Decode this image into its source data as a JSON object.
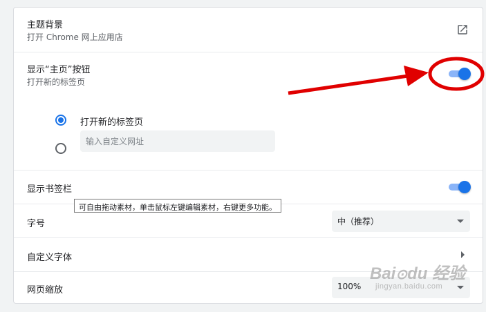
{
  "theme": {
    "title": "主题背景",
    "subtitle": "打开 Chrome 网上应用店",
    "icon": "open-in-new-icon"
  },
  "home_button": {
    "title": "显示“主页”按钮",
    "subtitle": "打开新的标签页",
    "enabled": true,
    "options": [
      {
        "label": "打开新的标签页",
        "selected": true
      },
      {
        "label": "",
        "selected": false,
        "placeholder": "输入自定义网址"
      }
    ]
  },
  "bookmarks_bar": {
    "title": "显示书签栏",
    "enabled": true
  },
  "tooltip": {
    "text": "可自由拖动素材，单击鼠标左键编辑素材，右键更多功能。"
  },
  "font_size": {
    "title": "字号",
    "value": "中（推荐）"
  },
  "custom_fonts": {
    "title": "自定义字体"
  },
  "page_zoom": {
    "title": "网页缩放",
    "value": "100%"
  },
  "colors": {
    "accent": "#1a73e8",
    "annotation": "#e00000"
  },
  "watermark": {
    "brand": "Bai du 经验",
    "url": "jingyan.baidu.com"
  }
}
